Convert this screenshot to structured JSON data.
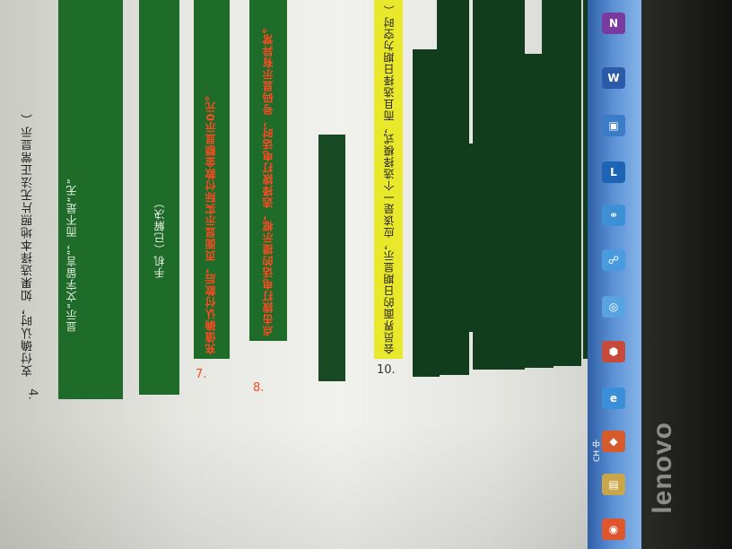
{
  "document": {
    "item4": {
      "number": "4.",
      "text": "支付确认时，如果选择本地照片无法正常显示（"
    },
    "item5_fragment": "显示“文字留言”，而不是“无”",
    "item6_fragment": "手机（已解决）",
    "item7": {
      "number": "7.",
      "text": "充值确认付款后，页面显示实际付款金额显示0元。"
    },
    "item8": {
      "number": "8.",
      "text": "点击拨打电话的提示框，选择拨打电话时，号码显示有异常。"
    },
    "item10": {
      "number": "10.",
      "text": "会员界面的日期显示，应该是一个选择模式，而且选择日期为空时（"
    }
  },
  "taskbar": {
    "icons": [
      {
        "name": "onenote-icon",
        "glyph": "N"
      },
      {
        "name": "word-icon",
        "glyph": "W"
      },
      {
        "name": "screenshot-icon",
        "glyph": "▣"
      },
      {
        "name": "lync-icon",
        "glyph": "L"
      },
      {
        "name": "connection-icon",
        "glyph": "⚭"
      },
      {
        "name": "network-icon",
        "glyph": "☍"
      },
      {
        "name": "wifi-icon",
        "glyph": "◎"
      },
      {
        "name": "antivirus-icon",
        "glyph": "⬢"
      },
      {
        "name": "ie-icon",
        "glyph": "e"
      },
      {
        "name": "windows-icon",
        "glyph": "◆"
      },
      {
        "name": "file-explorer-icon",
        "glyph": "▤"
      },
      {
        "name": "start-icon",
        "glyph": "◉"
      }
    ],
    "language": "CH 中"
  },
  "bezel_brand": "lenovo"
}
